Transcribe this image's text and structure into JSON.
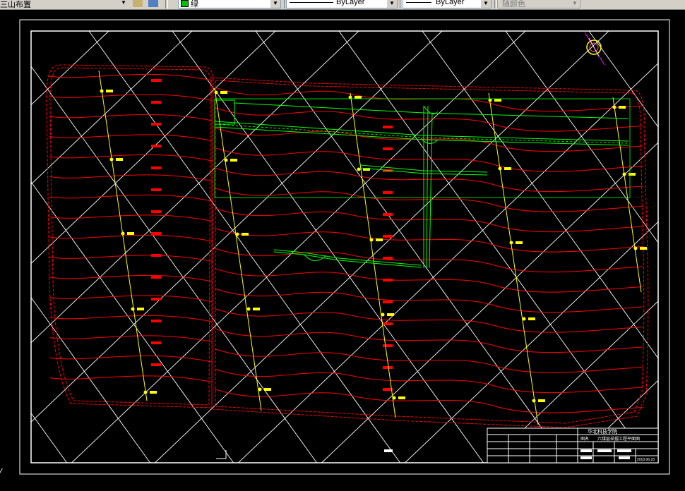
{
  "toolbar": {
    "layout_label": "三山布置",
    "color_value": "绿",
    "linetype_value": "ByLayer",
    "lineweight_value": "ByLayer",
    "plotstyle_value": "随颜色"
  },
  "title_block": {
    "school": "华北科技学院",
    "drawing_label": "图名",
    "drawing_name": "六煤层采掘工程平面图",
    "date": "2010.06.23"
  },
  "colors": {
    "contour": "#ff0000",
    "workings": "#00ff00",
    "grid": "#ffffff",
    "section_line": "#ffff00",
    "label_box": "#ff0000"
  }
}
